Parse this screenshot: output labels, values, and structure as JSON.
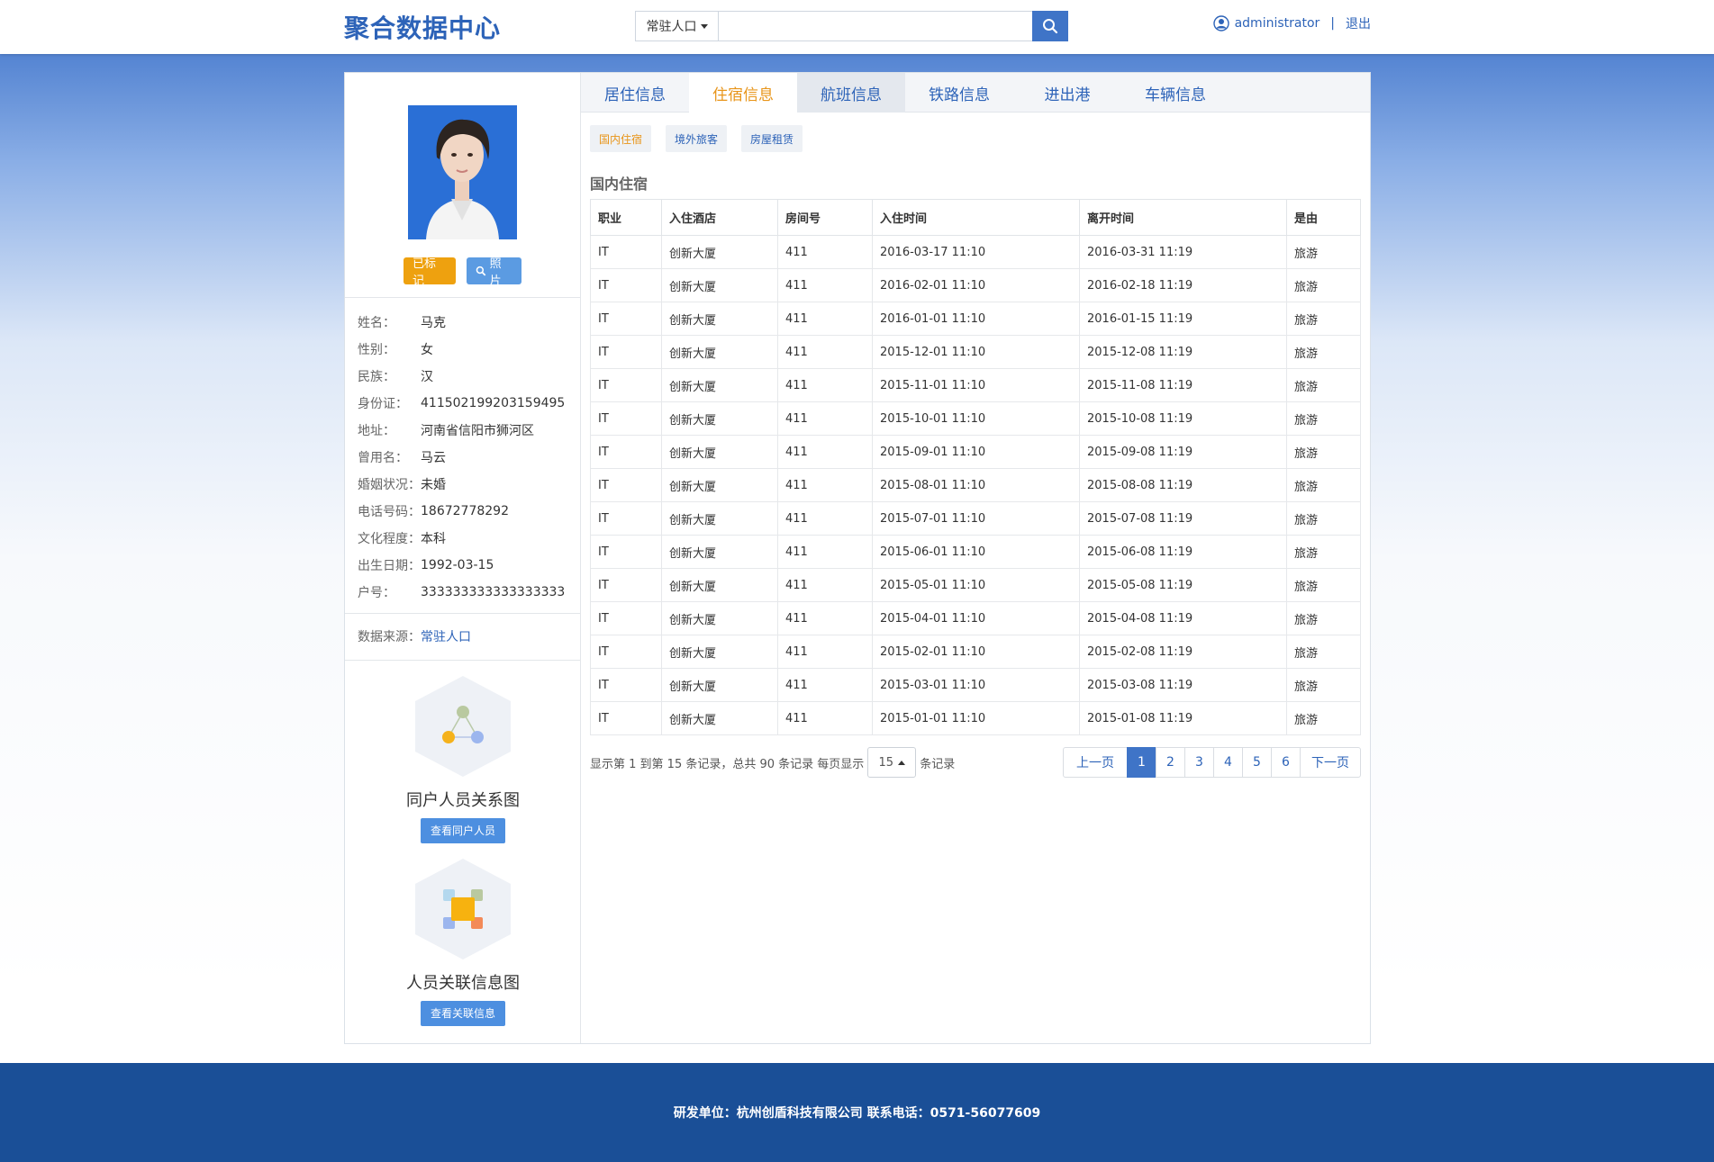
{
  "header": {
    "logo": "聚合数据中心",
    "search_type": "常驻人口",
    "search_value": "",
    "username": "administrator",
    "separator": "|",
    "logout": "退出"
  },
  "profile": {
    "btn_marked": "已标记",
    "btn_photo": "照片",
    "fields": [
      {
        "label": "姓名：",
        "value": "马克"
      },
      {
        "label": "性别：",
        "value": "女"
      },
      {
        "label": "民族：",
        "value": "汉"
      },
      {
        "label": "身份证：",
        "value": "411502199203159495"
      },
      {
        "label": "地址：",
        "value": "河南省信阳市狮河区"
      },
      {
        "label": "曾用名：",
        "value": "马云"
      },
      {
        "label": "婚姻状况：",
        "value": "未婚"
      },
      {
        "label": "电话号码：",
        "value": "18672778292"
      },
      {
        "label": "文化程度：",
        "value": "本科"
      },
      {
        "label": "出生日期：",
        "value": "1992-03-15"
      },
      {
        "label": "户号：",
        "value": "333333333333333333"
      }
    ],
    "source_label": "数据来源：",
    "source_value": "常驻人口",
    "graph1_title": "同户人员关系图",
    "graph1_btn": "查看同户人员",
    "graph2_title": "人员关联信息图",
    "graph2_btn": "查看关联信息"
  },
  "tabs": [
    "居住信息",
    "住宿信息",
    "航班信息",
    "铁路信息",
    "进出港",
    "车辆信息"
  ],
  "subtabs": [
    "国内住宿",
    "境外旅客",
    "房屋租赁"
  ],
  "section_title": "国内住宿",
  "table": {
    "headers": [
      "职业",
      "入住酒店",
      "房间号",
      "入住时间",
      "离开时间",
      "是由"
    ],
    "rows": [
      [
        "IT",
        "创新大厦",
        "411",
        "2016-03-17 11:10",
        "2016-03-31 11:19",
        "旅游"
      ],
      [
        "IT",
        "创新大厦",
        "411",
        "2016-02-01 11:10",
        "2016-02-18 11:19",
        "旅游"
      ],
      [
        "IT",
        "创新大厦",
        "411",
        "2016-01-01 11:10",
        "2016-01-15 11:19",
        "旅游"
      ],
      [
        "IT",
        "创新大厦",
        "411",
        "2015-12-01 11:10",
        "2015-12-08 11:19",
        "旅游"
      ],
      [
        "IT",
        "创新大厦",
        "411",
        "2015-11-01 11:10",
        "2015-11-08 11:19",
        "旅游"
      ],
      [
        "IT",
        "创新大厦",
        "411",
        "2015-10-01 11:10",
        "2015-10-08 11:19",
        "旅游"
      ],
      [
        "IT",
        "创新大厦",
        "411",
        "2015-09-01 11:10",
        "2015-09-08 11:19",
        "旅游"
      ],
      [
        "IT",
        "创新大厦",
        "411",
        "2015-08-01 11:10",
        "2015-08-08 11:19",
        "旅游"
      ],
      [
        "IT",
        "创新大厦",
        "411",
        "2015-07-01 11:10",
        "2015-07-08 11:19",
        "旅游"
      ],
      [
        "IT",
        "创新大厦",
        "411",
        "2015-06-01 11:10",
        "2015-06-08 11:19",
        "旅游"
      ],
      [
        "IT",
        "创新大厦",
        "411",
        "2015-05-01 11:10",
        "2015-05-08 11:19",
        "旅游"
      ],
      [
        "IT",
        "创新大厦",
        "411",
        "2015-04-01 11:10",
        "2015-04-08 11:19",
        "旅游"
      ],
      [
        "IT",
        "创新大厦",
        "411",
        "2015-02-01 11:10",
        "2015-02-08 11:19",
        "旅游"
      ],
      [
        "IT",
        "创新大厦",
        "411",
        "2015-03-01 11:10",
        "2015-03-08 11:19",
        "旅游"
      ],
      [
        "IT",
        "创新大厦",
        "411",
        "2015-01-01 11:10",
        "2015-01-08 11:19",
        "旅游"
      ]
    ]
  },
  "pagination": {
    "summary": "显示第 1 到第 15 条记录，总共 90 条记录 每页显示",
    "page_size": "15",
    "suffix": "条记录",
    "prev": "上一页",
    "pages": [
      "1",
      "2",
      "3",
      "4",
      "5",
      "6"
    ],
    "next": "下一页"
  },
  "footer": "研发单位：杭州创盾科技有限公司 联系电话：0571-56077609",
  "colors": {
    "brand_blue": "#2d63b8",
    "accent_orange": "#eea10f",
    "footer_bg": "#1a4f97"
  }
}
